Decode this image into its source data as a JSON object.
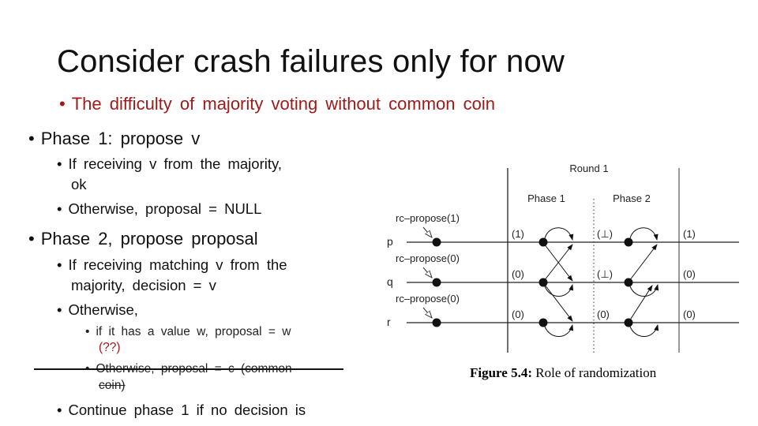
{
  "slide": {
    "title": "Consider crash failures only for now",
    "subtitle": "The  difficulty  of  majority  voting  without  common  coin",
    "bullets": {
      "phase1": "Phase  1:  propose  v",
      "phase1_sub1_a": "If  receiving  v  from  the  majority,",
      "phase1_sub1_b": "ok",
      "phase1_sub2": "Otherwise,  proposal  =  NULL",
      "phase2": "Phase  2,  propose  proposal",
      "phase2_sub1_a": "If  receiving  matching  v  from  the",
      "phase2_sub1_b": "majority,  decision  =  v",
      "phase2_sub2": "Otherwise,",
      "phase2_sub2_a_1": "if  it  has  a  value  w,  proposal  =  w",
      "phase2_sub2_a_2": "(??)",
      "phase2_sub2_b_1": "Otherwise,  proposal  =  c  (common",
      "phase2_sub2_b_2": "coin)",
      "continue": "Continue  phase  1  if  no  decision  is"
    }
  },
  "figure": {
    "round_label": "Round 1",
    "phase1_label": "Phase 1",
    "phase2_label": "Phase 2",
    "processes": [
      {
        "name": "p",
        "proposal_label": "rc–propose(1)",
        "phase1_value": "(1)",
        "phase2_value": "(⊥)",
        "end_value": "(1)"
      },
      {
        "name": "q",
        "proposal_label": "rc–propose(0)",
        "phase1_value": "(0)",
        "phase2_value": "(⊥)",
        "end_value": "(0)"
      },
      {
        "name": "r",
        "proposal_label": "rc–propose(0)",
        "phase1_value": "(0)",
        "phase2_value": "(0)",
        "end_value": "(0)"
      }
    ],
    "caption_bold": "Figure 5.4:",
    "caption_text": " Role of randomization"
  }
}
